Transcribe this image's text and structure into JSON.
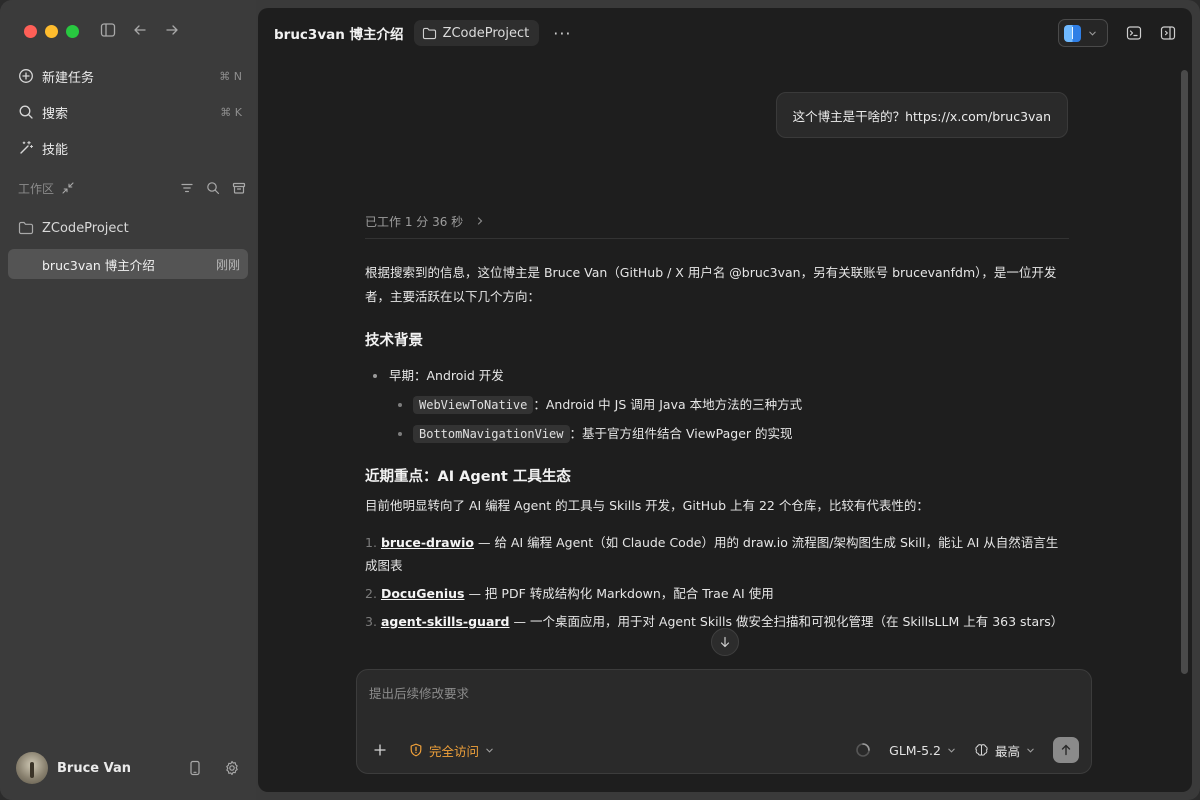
{
  "sidebar": {
    "new_task": {
      "label": "新建任务",
      "shortcut": "⌘ N"
    },
    "search": {
      "label": "搜索",
      "shortcut": "⌘ K"
    },
    "skills": {
      "label": "技能"
    },
    "workspace_label": "工作区",
    "project_name": "ZCodeProject",
    "conversation": {
      "title": "bruc3van 博主介绍",
      "time": "刚刚"
    },
    "user_name": "Bruce Van"
  },
  "header": {
    "title": "bruc3van 博主介绍",
    "project": "ZCodeProject",
    "more": "···"
  },
  "chat": {
    "user_message": "这个博主是干啥的？https://x.com/bruc3van",
    "worked": "已工作 1 分 36 秒",
    "intro": "根据搜索到的信息，这位博主是 Bruce Van（GitHub / X 用户名 @bruc3van，另有关联账号 brucevanfdm），是一位开发者，主要活跃在以下几个方向：",
    "section1_title": "技术背景",
    "bullet_early": "早期：Android 开发",
    "sub1_code": "WebViewToNative",
    "sub1_text": "：Android 中 JS 调用 Java 本地方法的三种方式",
    "sub2_code": "BottomNavigationView",
    "sub2_text": "：基于官方组件结合 ViewPager 的实现",
    "section2_title": "近期重点：AI Agent 工具生态",
    "section2_desc": "目前他明显转向了 AI 编程 Agent 的工具与 Skills 开发，GitHub 上有 22 个仓库，比较有代表性的：",
    "repos": [
      {
        "num": "1.",
        "name": "bruce-drawio",
        "desc": " — 给 AI 编程 Agent（如 Claude Code）用的 draw.io 流程图/架构图生成 Skill，能让 AI 从自然语言生成图表"
      },
      {
        "num": "2.",
        "name": "DocuGenius",
        "desc": " — 把 PDF 转成结构化 Markdown，配合 Trae AI 使用"
      },
      {
        "num": "3.",
        "name": "agent-skills-guard",
        "desc": " — 一个桌面应用，用于对 Agent Skills 做安全扫描和可视化管理（在 SkillsLLM 上有 363 stars）"
      }
    ]
  },
  "composer": {
    "placeholder": "提出后续修改要求",
    "access": "完全访问",
    "model": "GLM-5.2",
    "effort": "最高"
  }
}
